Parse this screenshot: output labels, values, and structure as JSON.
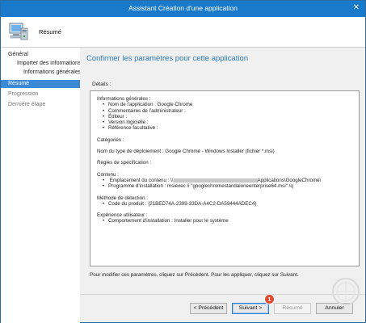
{
  "window": {
    "title": "Assistant Création d'une application",
    "close_glyph": "✕"
  },
  "header": {
    "page_title": "Résumé",
    "icon": "computer-setup-icon"
  },
  "sidebar": {
    "items": [
      {
        "label": "Général",
        "state": "normal"
      },
      {
        "label": "Importer des informations",
        "state": "normal"
      },
      {
        "label": "Informations générales",
        "state": "normal"
      },
      {
        "label": "Résumé",
        "state": "active"
      },
      {
        "label": "Progression",
        "state": "disabled"
      },
      {
        "label": "Dernière étape",
        "state": "disabled"
      }
    ]
  },
  "main": {
    "heading": "Confirmer les paramètres pour cette application",
    "details_label": "Détails :",
    "details": {
      "general_heading": "Informations générales :",
      "general_items": [
        "Nom de l'application : Google Chrome",
        "Commentaires de l'administrateur :",
        "Éditeur :",
        "Version logicielle :",
        "Référence facultative :"
      ],
      "categories": "Catégories :",
      "deployment_type": "Nom du type de déploiement : Google Chrome - Windows Installer (fichier *.msi)",
      "rules": "Règles de spécification :",
      "content_heading": "Contenu :",
      "content_location_prefix": "Emplacement du contenu : \\\\",
      "content_location_suffix": "Applications\\GoogleChrome\\",
      "install_program": "Programme d'installation : msiexec /i \"googlechromestandaloneenterprise64.msi\" /q",
      "detection_heading": "Méthode de détection :",
      "product_code": "Code du produit : {21BED74A-2399-33DA-A4C2-DA59444ADEC4}",
      "ux_heading": "Expérience utilisateur :",
      "install_behavior": "Comportement d'installation : Installer pour le système"
    },
    "footnote": "Pour modifier ces paramètres, cliquez sur Précédent. Pour les appliquer, cliquez sur Suivant."
  },
  "buttons": {
    "previous": "< Précédent",
    "next": "Suivant >",
    "summary": "Résumé",
    "cancel": "Annuler"
  },
  "annotation": {
    "badge": "1"
  },
  "colors": {
    "titlebar": "#1979ca",
    "accent": "#2a7ab8",
    "active_nav": "#3d89d6",
    "badge": "#e2482f"
  }
}
